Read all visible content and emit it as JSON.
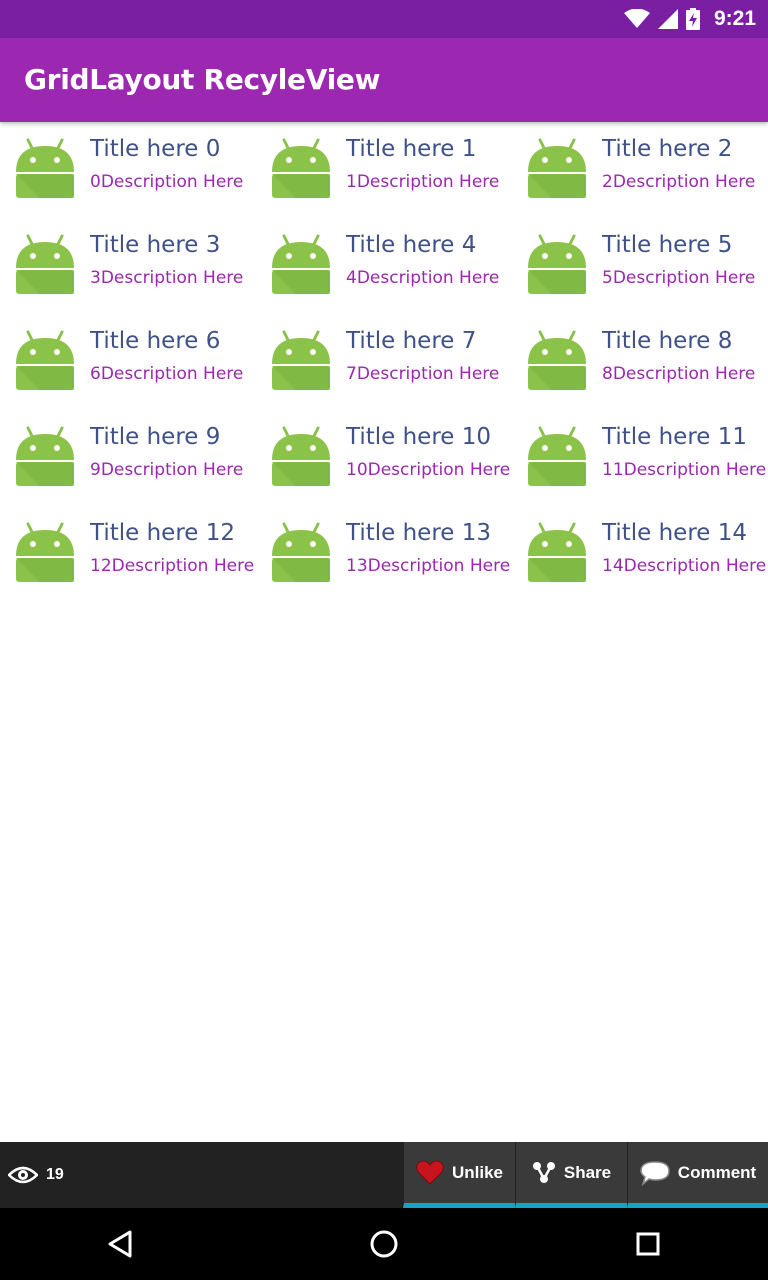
{
  "status_bar": {
    "time": "9:21"
  },
  "app_bar": {
    "title": "GridLayout RecyleView"
  },
  "grid_items": [
    {
      "title": "Title here 0",
      "description": "0Description Here"
    },
    {
      "title": "Title here 1",
      "description": "1Description Here"
    },
    {
      "title": "Title here 2",
      "description": "2Description Here"
    },
    {
      "title": "Title here 3",
      "description": "3Description Here"
    },
    {
      "title": "Title here 4",
      "description": "4Description Here"
    },
    {
      "title": "Title here 5",
      "description": "5Description Here"
    },
    {
      "title": "Title here 6",
      "description": "6Description Here"
    },
    {
      "title": "Title here 7",
      "description": "7Description Here"
    },
    {
      "title": "Title here 8",
      "description": "8Description Here"
    },
    {
      "title": "Title here 9",
      "description": "9Description Here"
    },
    {
      "title": "Title here 10",
      "description": "10Description Here"
    },
    {
      "title": "Title here 11",
      "description": "11Description Here"
    },
    {
      "title": "Title here 12",
      "description": "12Description Here"
    },
    {
      "title": "Title here 13",
      "description": "13Description Here"
    },
    {
      "title": "Title here 14",
      "description": "14Description Here"
    }
  ],
  "bottom_bar": {
    "views_count": "19",
    "unlike_label": "Unlike",
    "share_label": "Share",
    "comment_label": "Comment"
  },
  "colors": {
    "status_bar": "#7b1fa2",
    "app_bar": "#9c27b0",
    "title_text": "#3f5187",
    "description_text": "#9c27b0",
    "android_green": "#8bc34a",
    "accent_underline": "#17a2c9"
  },
  "icons": {
    "item": "android-robot-icon",
    "views": "eye-icon",
    "unlike": "heart-icon",
    "share": "share-icon",
    "comment": "comment-bubble-icon",
    "nav_back": "back-triangle-icon",
    "nav_home": "home-circle-icon",
    "nav_recents": "recents-square-icon"
  }
}
